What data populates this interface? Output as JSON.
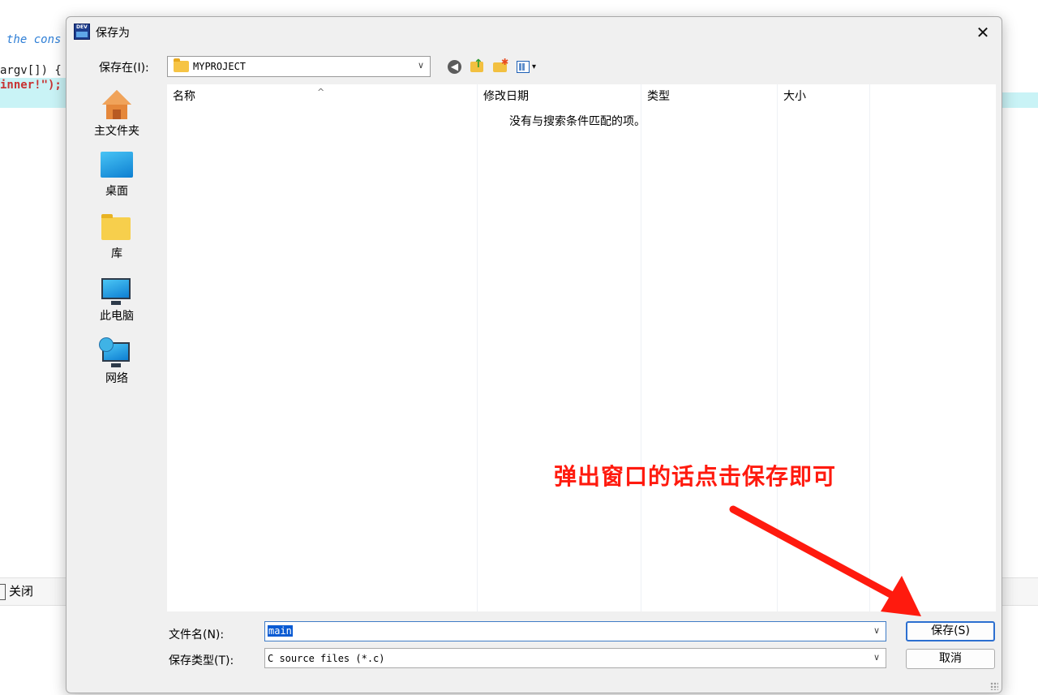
{
  "editor": {
    "code_line_1": "the cons",
    "code_line_2": "argv[]) {",
    "code_line_3": "inner!\");",
    "bottom_tab_label": "关闭"
  },
  "dialog": {
    "title": "保存为",
    "close_glyph": "✕",
    "save_in_label": "保存在(I):",
    "location": "MYPROJECT",
    "toolbar": {
      "back_glyph": "◀",
      "up_glyph": "↑",
      "newfolder_glyph": "✱",
      "view_glyph": "▾"
    },
    "places": [
      {
        "label": "主文件夹",
        "icon": "home-icon"
      },
      {
        "label": "桌面",
        "icon": "desktop-icon"
      },
      {
        "label": "库",
        "icon": "library-icon"
      },
      {
        "label": "此电脑",
        "icon": "pc-icon"
      },
      {
        "label": "网络",
        "icon": "network-icon"
      }
    ],
    "columns": [
      "名称",
      "修改日期",
      "类型",
      "大小"
    ],
    "sort_glyph": "^",
    "empty_message": "没有与搜索条件匹配的项。",
    "filename_label": "文件名(N):",
    "filename_value": "main",
    "filetype_label": "保存类型(T):",
    "filetype_value": "C source files (*.c)",
    "save_button": "保存(S)",
    "cancel_button": "取消",
    "combo_arrow": "∨"
  },
  "annotation": {
    "text": "弹出窗口的话点击保存即可",
    "color": "#ff1a0e"
  }
}
